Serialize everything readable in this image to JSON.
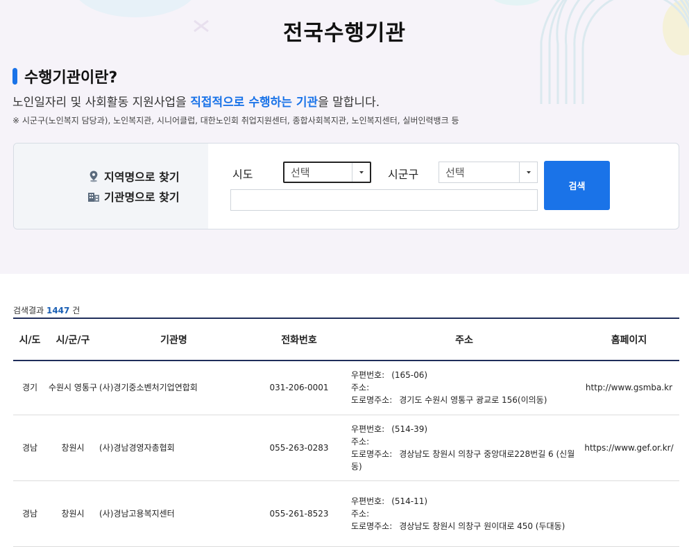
{
  "header": {
    "title": "전국수행기관"
  },
  "intro": {
    "section_title": "수행기관이란?",
    "desc_pre": "노인일자리 및 사회활동 지원사업을 ",
    "desc_highlight": "직접적으로 수행하는 기관",
    "desc_post": "을 말합니다.",
    "note": "※ 시군구(노인복지 담당과), 노인복지관, 시니어클럽, 대한노인회 취업지원센터, 종합사회복지관, 노인복지센터, 실버인력뱅크 등"
  },
  "search": {
    "option_region": "지역명으로 찾기",
    "option_name": "기관명으로 찾기",
    "sido_label": "시도",
    "sido_value": "선택",
    "sigungu_label": "시군구",
    "sigungu_value": "선택",
    "name_value": "",
    "button_label": "검색"
  },
  "result": {
    "prefix": "검색결과 ",
    "count": "1447",
    "suffix": " 건"
  },
  "table": {
    "headers": {
      "sido": "시/도",
      "sigungu": "시/군/구",
      "name": "기관명",
      "phone": "전화번호",
      "address": "주소",
      "homepage": "홈페이지"
    },
    "address_labels": {
      "zip": "우편번호:",
      "addr": "주소:",
      "road": "도로명주소:"
    },
    "rows": [
      {
        "sido": "경기",
        "sigungu": "수원시 영통구",
        "name": "(사)경기중소벤처기업연합회",
        "phone": "031-206-0001",
        "zip": "(165-06)",
        "addr": "",
        "road": "경기도 수원시 영통구 광교로 156(이의동)",
        "homepage": "http://www.gsmba.kr"
      },
      {
        "sido": "경남",
        "sigungu": "창원시",
        "name": "(사)경남경영자총협회",
        "phone": "055-263-0283",
        "zip": "(514-39)",
        "addr": "",
        "road": "경상남도 창원시 의창구 중앙대로228번길 6 (신월동)",
        "homepage": "https://www.gef.or.kr/"
      },
      {
        "sido": "경남",
        "sigungu": "창원시",
        "name": "(사)경남고용복지센터",
        "phone": "055-261-8523",
        "zip": "(514-11)",
        "addr": "",
        "road": "경상남도 창원시 의창구 원이대로 450 (두대동)",
        "homepage": ""
      }
    ]
  },
  "colors": {
    "accent": "#1a73e8",
    "hero_bg": "#f6f3f9",
    "table_rule": "#1f2d5a"
  }
}
